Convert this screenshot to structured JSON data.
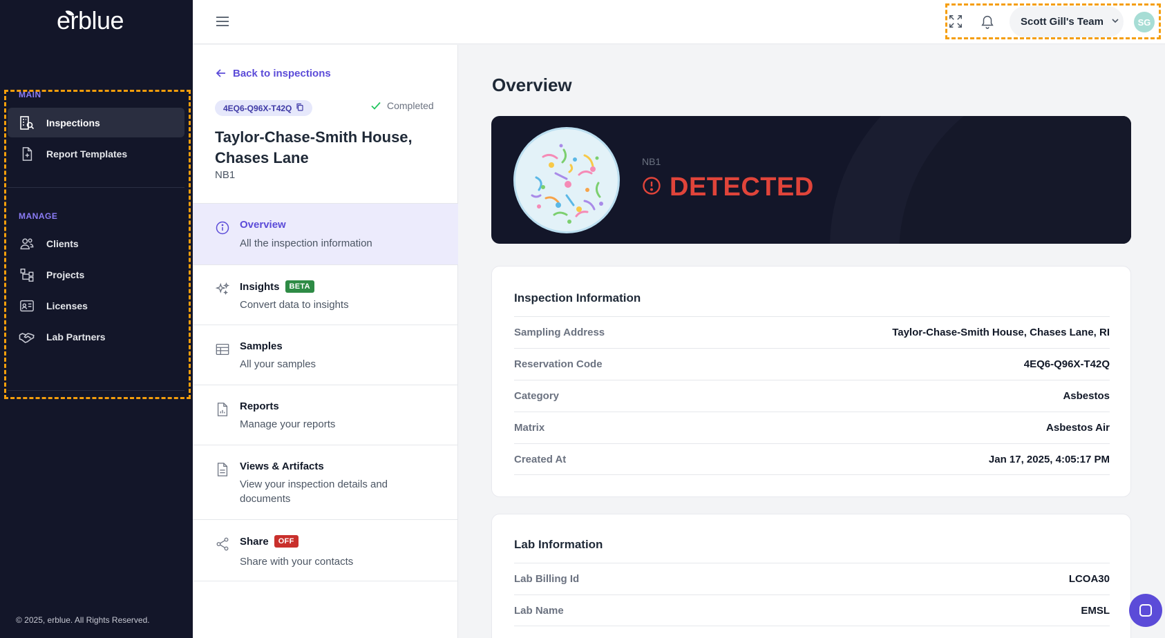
{
  "brand": {
    "logo_text": "erblue"
  },
  "sidebar": {
    "main_label": "MAIN",
    "manage_label": "MANAGE",
    "main_items": [
      {
        "label": "Inspections",
        "icon": "building-search-icon",
        "active": true
      },
      {
        "label": "Report Templates",
        "icon": "file-plus-icon"
      }
    ],
    "manage_items": [
      {
        "label": "Clients",
        "icon": "users-icon"
      },
      {
        "label": "Projects",
        "icon": "hierarchy-icon"
      },
      {
        "label": "Licenses",
        "icon": "id-card-icon"
      },
      {
        "label": "Lab Partners",
        "icon": "handshake-icon"
      }
    ],
    "footer": "© 2025, erblue. All Rights Reserved."
  },
  "topbar": {
    "team_name": "Scott Gill's Team",
    "avatar_initials": "SG"
  },
  "inspection": {
    "back_label": "Back to inspections",
    "code": "4EQ6-Q96X-T42Q",
    "status": "Completed",
    "title": "Taylor-Chase-Smith House, Chases Lane",
    "subtitle": "NB1",
    "nav": [
      {
        "title": "Overview",
        "desc": "All the inspection information",
        "icon": "info-icon",
        "active": true
      },
      {
        "title": "Insights",
        "desc": "Convert data to insights",
        "icon": "sparkles-icon",
        "badge": "BETA"
      },
      {
        "title": "Samples",
        "desc": "All your samples",
        "icon": "table-icon"
      },
      {
        "title": "Reports",
        "desc": "Manage your reports",
        "icon": "report-file-icon"
      },
      {
        "title": "Views & Artifacts",
        "desc": "View your inspection details and documents",
        "icon": "document-icon"
      },
      {
        "title": "Share",
        "desc": "Share with your contacts",
        "icon": "share-icon",
        "badge": "OFF"
      }
    ]
  },
  "overview": {
    "heading": "Overview",
    "hero_label": "NB1",
    "hero_status": "DETECTED",
    "colors": {
      "detected": "#e0443a",
      "accent": "#5b4bd8",
      "sidebar_bg": "#131629"
    }
  },
  "inspection_info": {
    "heading": "Inspection Information",
    "rows": [
      {
        "key": "Sampling Address",
        "value": "Taylor-Chase-Smith House, Chases Lane, RI"
      },
      {
        "key": "Reservation Code",
        "value": "4EQ6-Q96X-T42Q"
      },
      {
        "key": "Category",
        "value": "Asbestos"
      },
      {
        "key": "Matrix",
        "value": "Asbestos Air"
      },
      {
        "key": "Created At",
        "value": "Jan 17, 2025, 4:05:17 PM"
      }
    ]
  },
  "lab_info": {
    "heading": "Lab Information",
    "rows": [
      {
        "key": "Lab Billing Id",
        "value": "LCOA30"
      },
      {
        "key": "Lab Name",
        "value": "EMSL"
      }
    ]
  }
}
